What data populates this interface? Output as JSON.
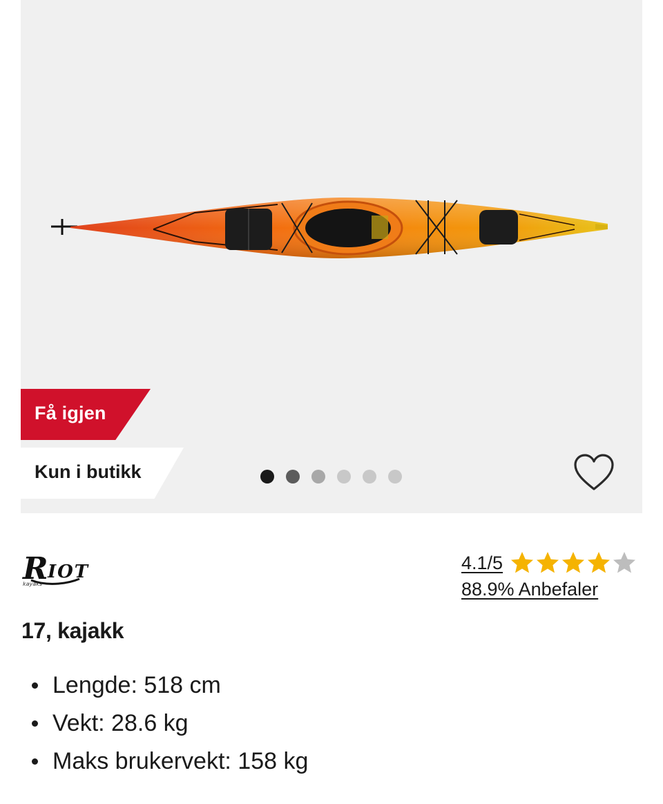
{
  "gallery": {
    "badge_sale": "Få igjen",
    "badge_availability": "Kun i butikk",
    "dots": [
      {
        "color": "#1a1a1a"
      },
      {
        "color": "#5c5c5c"
      },
      {
        "color": "#a8a8a8"
      },
      {
        "color": "#c8c8c8"
      },
      {
        "color": "#c8c8c8"
      },
      {
        "color": "#c8c8c8"
      }
    ],
    "favorite_icon": "heart-outline-icon"
  },
  "brand": {
    "name": "RIOT",
    "tagline": "kayaks"
  },
  "rating": {
    "score": "4.1/5",
    "stars_value": 4.1,
    "stars_max": 5,
    "star_color": "#f5b301",
    "star_empty_color": "#bdbdbd",
    "recommend": "88.9% Anbefaler"
  },
  "product": {
    "title": "17, kajakk",
    "specs": [
      "Lengde: 518 cm",
      "Vekt: 28.6 kg",
      "Maks brukervekt: 158 kg"
    ]
  },
  "colors": {
    "accent_red": "#d0112b",
    "gallery_bg": "#f0f0f0"
  }
}
